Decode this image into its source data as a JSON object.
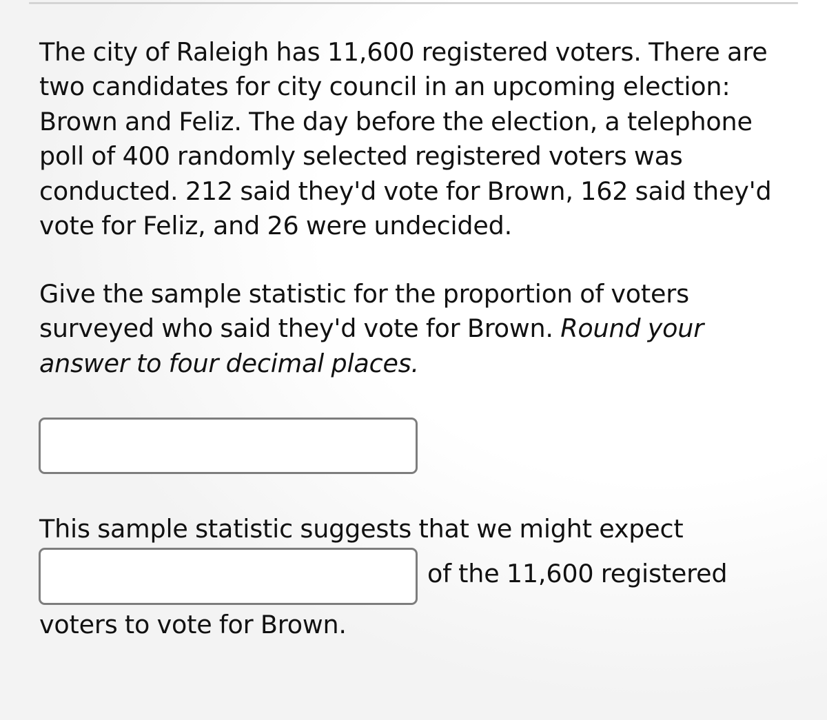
{
  "problem": {
    "intro_text": "The city of Raleigh has 11,600 registered voters. There are two candidates for city council in an upcoming election: Brown and Feliz. The day before the election, a telephone poll of 400 randomly selected registered voters was conducted. 212 said they'd vote for Brown, 162 said they'd vote for Feliz, and 26 were undecided.",
    "question": {
      "text": "Give the sample statistic for the proportion of voters surveyed who said they'd vote for Brown.",
      "instruction_italic": "Round your answer to four decimal places."
    },
    "answer_1": {
      "value": "",
      "placeholder": ""
    },
    "followup": {
      "line_before": "This sample statistic suggests that we might expect",
      "text_after_box": "of the 11,600 registered",
      "line_after": "voters to vote for Brown."
    },
    "answer_2": {
      "value": "",
      "placeholder": ""
    }
  }
}
